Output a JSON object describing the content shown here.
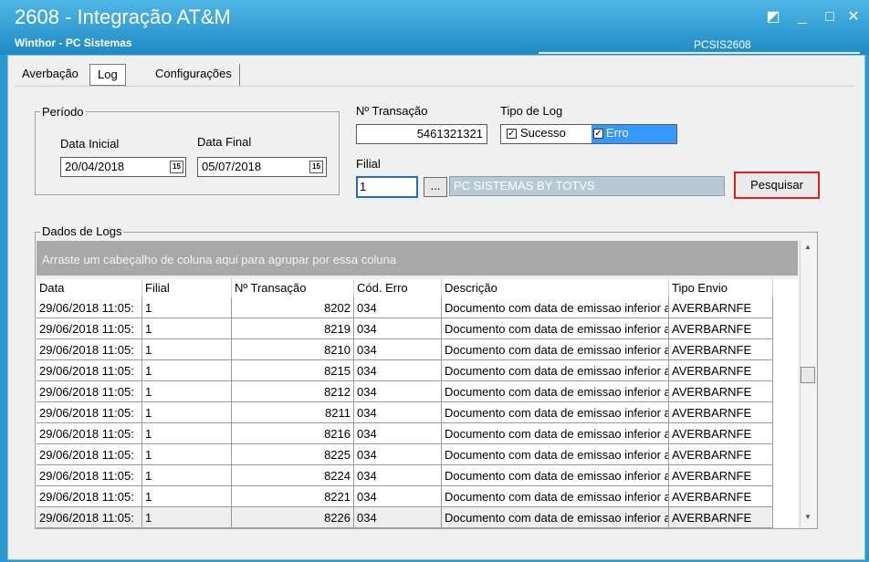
{
  "window": {
    "title": "2608 - Integração AT&M",
    "subtitle": "Winthor - PC Sistemas",
    "code": "PCSIS2608",
    "buttons": {
      "restore": "◩",
      "minimize": "_",
      "maximize": "□",
      "close": "✕"
    }
  },
  "tabs": [
    {
      "label": "Averbação"
    },
    {
      "label": "Log"
    },
    {
      "label": "Configurações"
    }
  ],
  "periodo": {
    "title": "Período",
    "data_inicial_label": "Data Inicial",
    "data_inicial_value": "20/04/2018",
    "data_final_label": "Data Final",
    "data_final_value": "05/07/2018",
    "calendar_icon": "15"
  },
  "transacao": {
    "label": "Nº Transação",
    "value": "5461321321"
  },
  "tipo_log": {
    "label": "Tipo de Log",
    "options": [
      {
        "label": "Sucesso",
        "checked": true
      },
      {
        "label": "Erro",
        "checked": true
      }
    ]
  },
  "filial": {
    "label": "Filial",
    "value": "1",
    "lookup_button": "...",
    "name": "PC SISTEMAS BY TOTVS"
  },
  "pesquisar_label": "Pesquisar",
  "dados": {
    "title": "Dados de Logs",
    "group_hint": "Arraste um cabeçalho de coluna aqui para agrupar por essa coluna",
    "columns": [
      "Data",
      "Filial",
      "Nº Transação",
      "Cód. Erro",
      "Descrição",
      "Tipo Envio"
    ],
    "rows": [
      [
        "29/06/2018 11:05:",
        "1",
        "8202",
        "034",
        "Documento com data de emissao inferior a",
        "AVERBARNFE"
      ],
      [
        "29/06/2018 11:05:",
        "1",
        "8219",
        "034",
        "Documento com data de emissao inferior a",
        "AVERBARNFE"
      ],
      [
        "29/06/2018 11:05:",
        "1",
        "8210",
        "034",
        "Documento com data de emissao inferior a",
        "AVERBARNFE"
      ],
      [
        "29/06/2018 11:05:",
        "1",
        "8215",
        "034",
        "Documento com data de emissao inferior a",
        "AVERBARNFE"
      ],
      [
        "29/06/2018 11:05:",
        "1",
        "8212",
        "034",
        "Documento com data de emissao inferior a",
        "AVERBARNFE"
      ],
      [
        "29/06/2018 11:05:",
        "1",
        "8211",
        "034",
        "Documento com data de emissao inferior a",
        "AVERBARNFE"
      ],
      [
        "29/06/2018 11:05:",
        "1",
        "8216",
        "034",
        "Documento com data de emissao inferior a",
        "AVERBARNFE"
      ],
      [
        "29/06/2018 11:05:",
        "1",
        "8225",
        "034",
        "Documento com data de emissao inferior a",
        "AVERBARNFE"
      ],
      [
        "29/06/2018 11:05:",
        "1",
        "8224",
        "034",
        "Documento com data de emissao inferior a",
        "AVERBARNFE"
      ],
      [
        "29/06/2018 11:05:",
        "1",
        "8221",
        "034",
        "Documento com data de emissao inferior a",
        "AVERBARNFE"
      ],
      [
        "29/06/2018 11:05:",
        "1",
        "8226",
        "034",
        "Documento com data de emissao inferior a",
        "AVERBARNFE"
      ]
    ],
    "scroll_up": "▲",
    "scroll_down": "▼"
  }
}
